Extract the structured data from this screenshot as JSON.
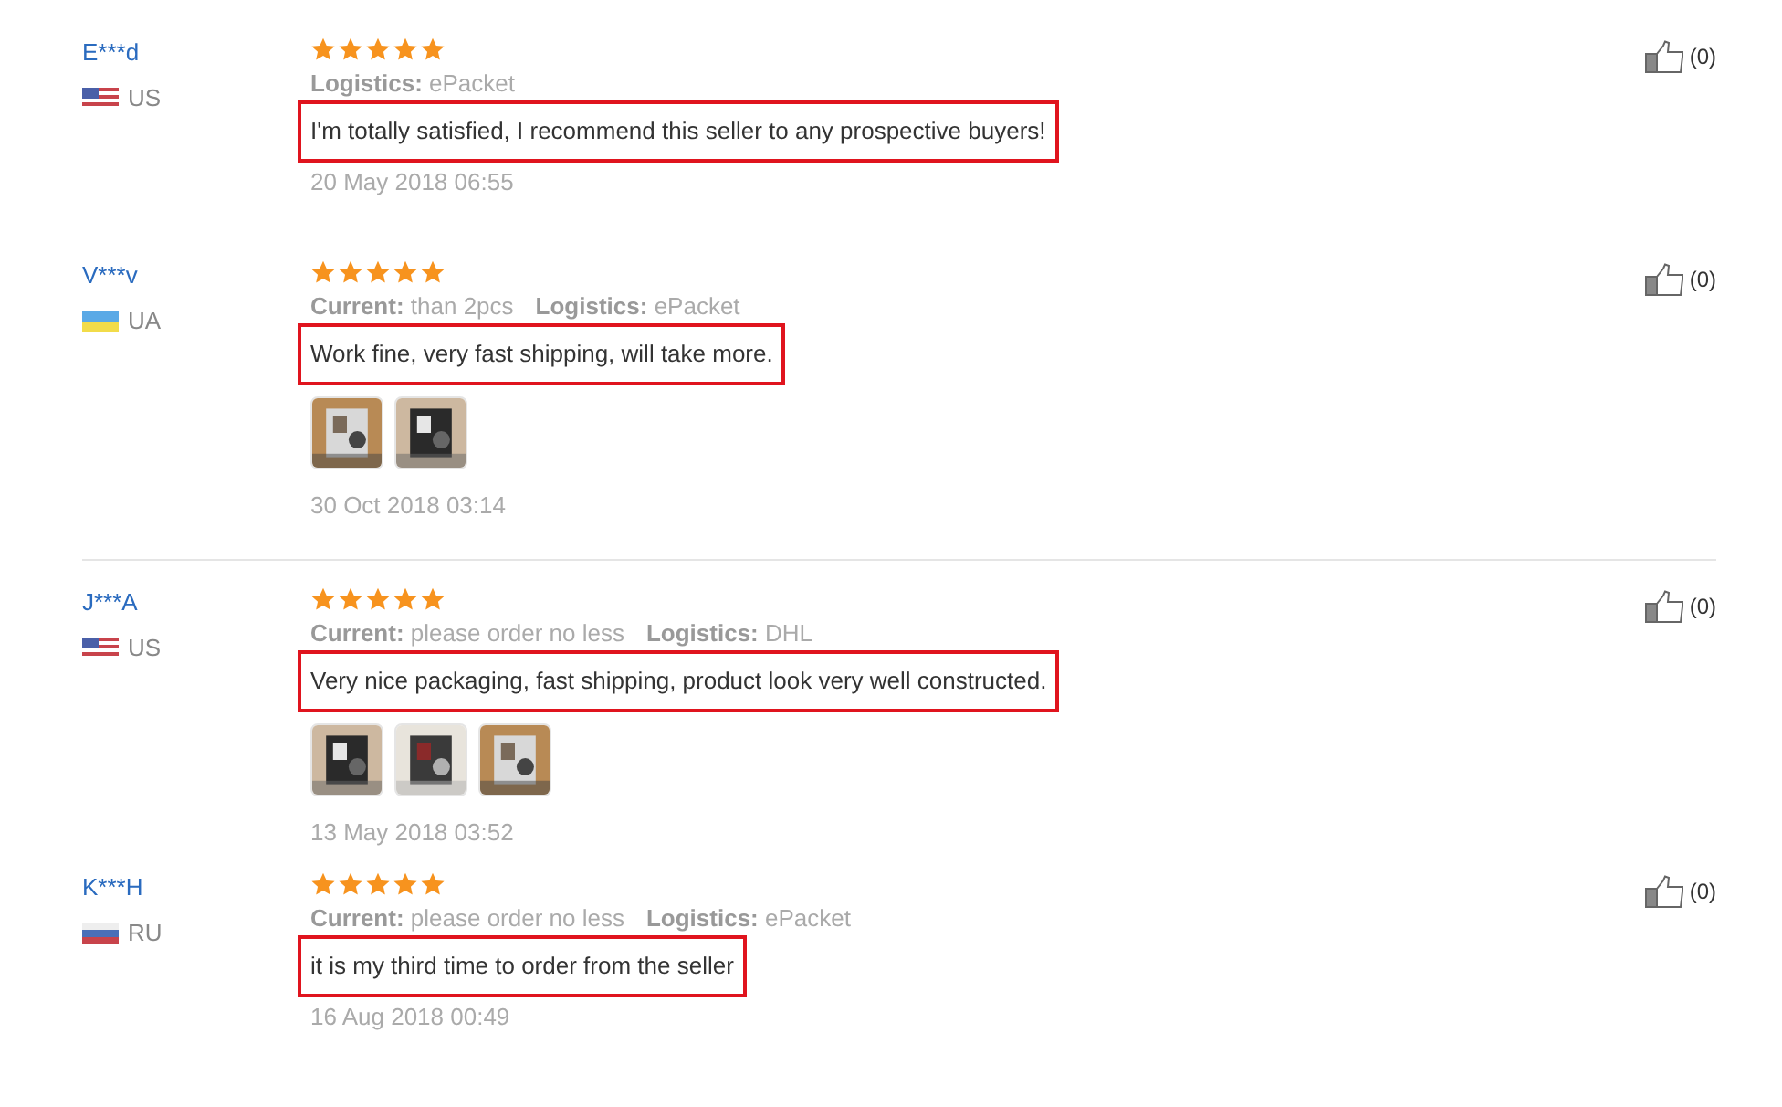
{
  "reviews": [
    {
      "user": "E***d",
      "flag": {
        "kind": "us"
      },
      "country": "US",
      "stars": 5,
      "meta": [
        {
          "label": "Logistics:",
          "value": "ePacket"
        }
      ],
      "comment": "I'm totally satisfied, I recommend this seller to any prospective buyers!",
      "highlighted": true,
      "date": "20 May 2018 06:55",
      "likes": "(0)",
      "divider_above": false
    },
    {
      "user": "V***v",
      "flag": {
        "kind": "ua"
      },
      "country": "UA",
      "stars": 5,
      "meta": [
        {
          "label": "Current:",
          "value": "than 2pcs"
        },
        {
          "label": "Logistics:",
          "value": "ePacket"
        }
      ],
      "comment": "Work fine, very fast shipping, will take more.",
      "highlighted": true,
      "photos": [
        {
          "kind": "picture"
        },
        {
          "kind": "picture"
        }
      ],
      "date": "30 Oct 2018 03:14",
      "likes": "(0)",
      "divider_above": false
    },
    {
      "user": "J***A",
      "flag": {
        "kind": "us"
      },
      "country": "US",
      "stars": 5,
      "meta": [
        {
          "label": "Current:",
          "value": "please order no less"
        },
        {
          "label": "Logistics:",
          "value": "DHL"
        }
      ],
      "comment": "Very nice packaging, fast shipping, product look very well constructed.",
      "highlighted": true,
      "photos": [
        {
          "kind": "picture"
        },
        {
          "kind": "picture"
        },
        {
          "kind": "picture"
        }
      ],
      "date": "13 May 2018 03:52",
      "likes": "(0)",
      "divider_above": true
    },
    {
      "user": "K***H",
      "flag": {
        "kind": "ru"
      },
      "country": "RU",
      "stars": 5,
      "meta": [
        {
          "label": "Current:",
          "value": "please order no less"
        },
        {
          "label": "Logistics:",
          "value": "ePacket"
        }
      ],
      "comment": "it is my third time to order from the seller",
      "highlighted": true,
      "date": "16 Aug 2018 00:49",
      "likes": "(0)",
      "divider_above": false
    }
  ]
}
